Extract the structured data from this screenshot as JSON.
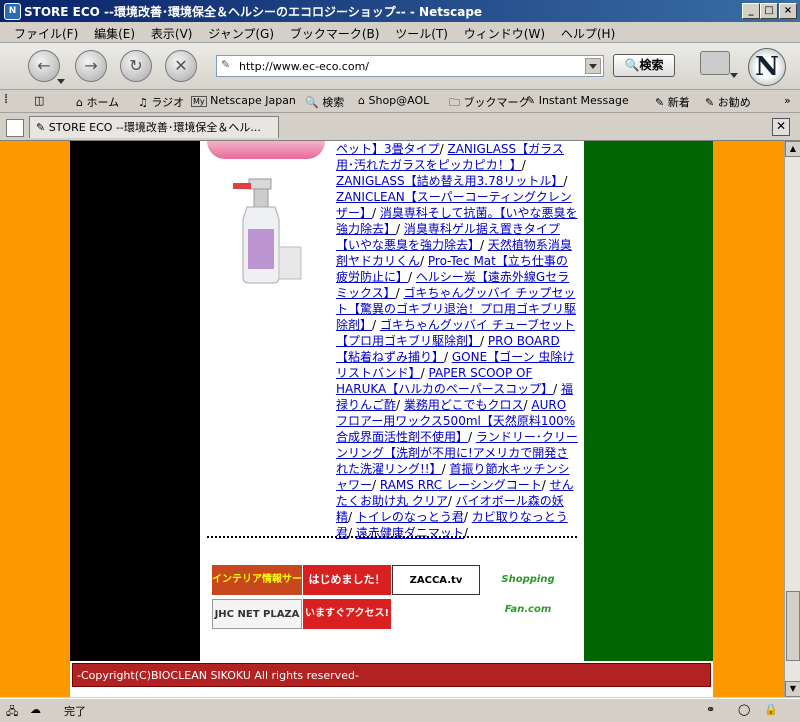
{
  "window": {
    "title": "STORE ECO --環境改善･環境保全＆ヘルシーのエコロジーショップ-- - Netscape",
    "app_icon": "netscape-icon",
    "buttons": [
      "_",
      "□",
      "×"
    ]
  },
  "menu": [
    "ファイル(F)",
    "編集(E)",
    "表示(V)",
    "ジャンプ(G)",
    "ブックマーク(B)",
    "ツール(T)",
    "ウィンドウ(W)",
    "ヘルプ(H)"
  ],
  "navbar": {
    "url": "http://www.ec-eco.com/",
    "search_label": "検索"
  },
  "personal_toolbar": {
    "items": [
      "ホーム",
      "ラジオ",
      "Netscape Japan",
      "検索",
      "Shop@AOL",
      "ブックマーク",
      "Instant Message",
      "新着",
      "お勧め"
    ]
  },
  "tab": {
    "title": "STORE ECO --環境改善･環境保全＆ヘル..."
  },
  "page": {
    "links": [
      "ペット】3畳タイプ",
      "ZANIGLASS【ガラス用･汚れたガラスをピッカピカ！】",
      "ZANIGLASS【詰め替え用3.78リットル】",
      "ZANICLEAN【スーパーコーティングクレンザー】",
      "消臭専科そして抗菌。【いやな悪臭を強力除去】",
      "消臭専科ゲル据え置きタイプ【いやな悪臭を強力除去】",
      "天然植物系消臭剤ヤドカリくん",
      "Pro-Tec Mat【立ち仕事の疲労防止に】",
      "ヘルシー炭【遠赤外線Gセラミックス】",
      "ゴキちゃんグッバイ チップセット【驚異のゴキブリ退治！プロ用ゴキブリ駆除剤】",
      "ゴキちゃんグッバイ チューブセット【プロ用ゴキブリ駆除剤】",
      "PRO BOARD【粘着ねずみ捕り】",
      "GONE【ゴーン 虫除けリストバンド】",
      "PAPER SCOOP OF HARUKA【ハルカのペーパースコップ】",
      "福禄りんご酢",
      "業務用どこでもクロス",
      "AUROフロアー用ワックス500ml【天然原料100%合成界面活性剤不使用】",
      "ランドリー･クリーンリング【洗剤が不用に!アメリカで開発された洗濯リング!!】",
      "首振り節水キッチンシャワー",
      "RAMS RRC レーシングコート",
      "せんたくお助け丸 クリア",
      "バイオボール森の妖精",
      "トイレのなっとう君",
      "カビ取りなっとう君",
      "遠赤健康ダニマット"
    ],
    "banners": [
      "インテリア情報サーチ",
      "はじめました！",
      "ZACCA.tv",
      "Shopping Fan.com",
      "JHC NET PLAZA",
      "いますぐアクセス!"
    ],
    "footer": "-Copyright(C)BIOCLEAN SIKOKU All rights reserved-"
  },
  "status": {
    "text": "完了"
  }
}
